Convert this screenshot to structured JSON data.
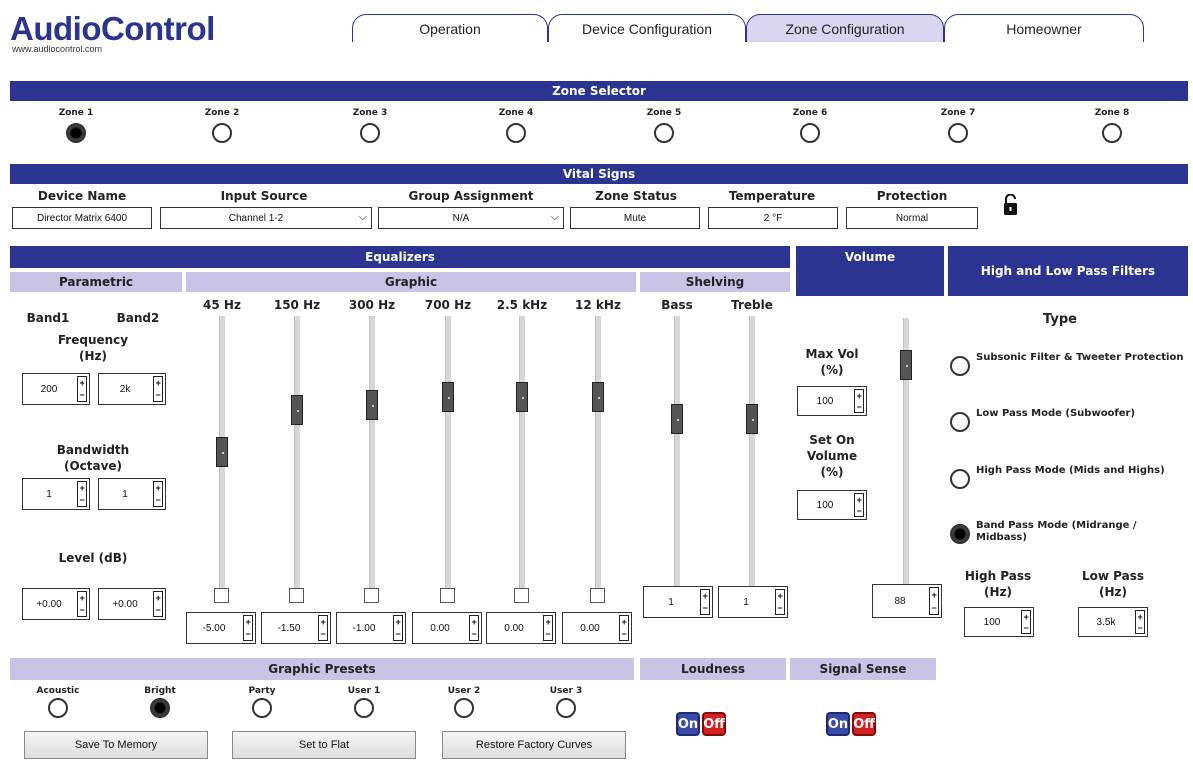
{
  "brand": {
    "name": "AudioControl",
    "url": "www.audiocontrol.com"
  },
  "tabs": [
    {
      "label": "Operation",
      "active": false
    },
    {
      "label": "Device Configuration",
      "active": false
    },
    {
      "label": "Zone Configuration",
      "active": true
    },
    {
      "label": "Homeowner",
      "active": false
    }
  ],
  "zone_selector": {
    "title": "Zone Selector",
    "zones": [
      "Zone 1",
      "Zone 2",
      "Zone 3",
      "Zone 4",
      "Zone 5",
      "Zone 6",
      "Zone 7",
      "Zone 8"
    ],
    "selected": "Zone 1"
  },
  "vital_signs": {
    "title": "Vital Signs",
    "device_name_label": "Device Name",
    "device_name": "Director Matrix 6400",
    "input_source_label": "Input Source",
    "input_source": "Channel 1-2",
    "group_label": "Group Assignment",
    "group": "N/A",
    "zone_status_label": "Zone Status",
    "zone_status": "Mute",
    "temperature_label": "Temperature",
    "temperature": "2 °F",
    "protection_label": "Protection",
    "protection": "Normal"
  },
  "equalizers": {
    "title": "Equalizers",
    "parametric": {
      "title": "Parametric",
      "band1": "Band1",
      "band2": "Band2",
      "frequency_label": "Frequency (Hz)",
      "freq1": "200",
      "freq2": "2k",
      "bandwidth_label": "Bandwidth (Octave)",
      "bw1": "1",
      "bw2": "1",
      "level_label": "Level (dB)",
      "level1": "+0.00",
      "level2": "+0.00"
    },
    "graphic": {
      "title": "Graphic",
      "bands": [
        {
          "freq": "45 Hz",
          "value": "-5.00",
          "pos": 0.44
        },
        {
          "freq": "150 Hz",
          "value": "-1.50",
          "pos": 0.29
        },
        {
          "freq": "300 Hz",
          "value": "-1.00",
          "pos": 0.27
        },
        {
          "freq": "700 Hz",
          "value": "0.00",
          "pos": 0.24
        },
        {
          "freq": "2.5 kHz",
          "value": "0.00",
          "pos": 0.24
        },
        {
          "freq": "12 kHz",
          "value": "0.00",
          "pos": 0.24
        }
      ]
    },
    "shelving": {
      "title": "Shelving",
      "bands": [
        {
          "name": "Bass",
          "value": "1",
          "pos": 0.32
        },
        {
          "name": "Treble",
          "value": "1",
          "pos": 0.32
        }
      ]
    }
  },
  "volume": {
    "title": "Volume",
    "max_vol_label": "Max Vol (%)",
    "max_vol": "100",
    "set_on_label": "Set On Volume (%)",
    "set_on": "100",
    "value": "88",
    "pos": 0.12
  },
  "filters": {
    "title": "High and Low Pass Filters",
    "type_label": "Type",
    "options": [
      {
        "label": "Subsonic Filter & Tweeter Protection",
        "selected": false
      },
      {
        "label": "Low Pass Mode (Subwoofer)",
        "selected": false
      },
      {
        "label": "High Pass Mode (Mids and Highs)",
        "selected": false
      },
      {
        "label": "Band Pass Mode (Midrange / Midbass)",
        "selected": true
      }
    ],
    "high_pass_label": "High Pass (Hz)",
    "high_pass": "100",
    "low_pass_label": "Low Pass (Hz)",
    "low_pass": "3.5k"
  },
  "presets": {
    "title": "Graphic Presets",
    "items": [
      "Acoustic",
      "Bright",
      "Party",
      "User 1",
      "User 2",
      "User 3"
    ],
    "selected": "Bright",
    "save_label": "Save To Memory",
    "flat_label": "Set to Flat",
    "restore_label": "Restore Factory Curves"
  },
  "loudness": {
    "title": "Loudness",
    "on": "On",
    "off": "Off"
  },
  "signal_sense": {
    "title": "Signal Sense",
    "on": "On",
    "off": "Off"
  }
}
